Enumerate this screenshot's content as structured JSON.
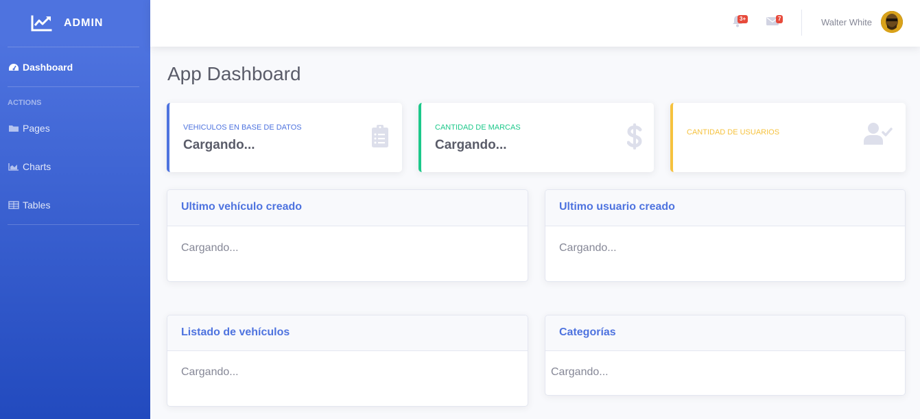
{
  "brand": {
    "title": "ADMIN"
  },
  "sidebar": {
    "dashboard": "Dashboard",
    "heading": "ACTIONS",
    "items": [
      {
        "label": "Pages",
        "icon": "folder-icon"
      },
      {
        "label": "Charts",
        "icon": "chart-area-icon"
      },
      {
        "label": "Tables",
        "icon": "table-icon"
      }
    ]
  },
  "topbar": {
    "alerts_count": "3+",
    "messages_count": "7",
    "user_name": "Walter White"
  },
  "page": {
    "title": "App Dashboard"
  },
  "stats": [
    {
      "label": "VEHICULOS EN BASE DE DATOS",
      "value": "Cargando...",
      "color": "#4e73df",
      "icon": "clipboard-list-icon"
    },
    {
      "label": "CANTIDAD DE MARCAS",
      "value": "Cargando...",
      "color": "#1cc88a",
      "icon": "dollar-sign-icon"
    },
    {
      "label": "CANTIDAD DE USUARIOS",
      "value": "",
      "color": "#f6c23e",
      "icon": "user-check-icon"
    }
  ],
  "panels": [
    {
      "title": "Ultimo vehículo creado",
      "body": "Cargando..."
    },
    {
      "title": "Ultimo usuario creado",
      "body": "Cargando..."
    },
    {
      "title": "Listado de vehículos",
      "body": "Cargando..."
    },
    {
      "title": "Categorías",
      "body": "Cargando..."
    }
  ],
  "colors": {
    "primary": "#4e73df",
    "success": "#1cc88a",
    "warning": "#f6c23e",
    "danger": "#e74a3b"
  }
}
